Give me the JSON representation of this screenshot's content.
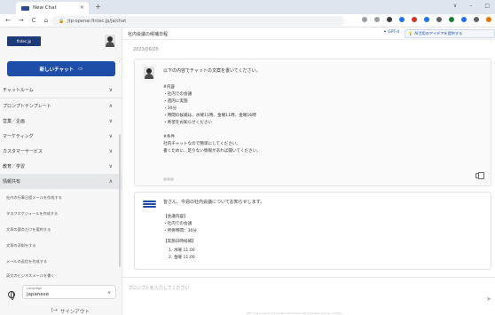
{
  "browser": {
    "tab_title": "New Chat",
    "tab_close": "×",
    "new_tab": "+",
    "window_controls": [
      "∨",
      "–",
      "□"
    ],
    "back": "←",
    "forward": "→",
    "reload": "C",
    "home": "⌂",
    "url": "jtp-openai.fintec.jp/ja/chat"
  },
  "sidebar": {
    "logo_text": "fintec.jp",
    "new_chat_label": "新しいチャット",
    "items": [
      {
        "label": "チャットルーム",
        "chevron": "∨"
      },
      {
        "label": "プロンプトテンプレート",
        "chevron": "∧"
      },
      {
        "label": "営業／企画",
        "chevron": "∨"
      },
      {
        "label": "マーケティング",
        "chevron": "∨"
      },
      {
        "label": "カスタマーサービス",
        "chevron": "∨"
      },
      {
        "label": "教育／学習",
        "chevron": "∨"
      },
      {
        "label": "情報共有",
        "chevron": "∧"
      }
    ],
    "sub_items": [
      "社内の行事日程メールを作成する",
      "タスクスケジュールを作成する",
      "文章の要点だけを要約する",
      "文章の添削をする",
      "メールの返信を作成する",
      "英文のビジネスメールを書く"
    ],
    "language_label": "Language",
    "language_value": "Japanese",
    "language_chevron": "∨",
    "signout_label": "サインアウト"
  },
  "main": {
    "title": "社内会議の候補日程",
    "gpt_button": "GPT-4",
    "idea_button": "AI活用のアイデアを提供する",
    "date": "2023/06/05",
    "user_message": {
      "lines": [
        "以下の内容でチャットの文案を書いてください。",
        "",
        "#内容",
        "・社内での会議",
        "・週内に実施",
        "・30分",
        "・時間の候補は、水曜11時、金曜11時、金曜16時",
        "・希望をお知らせください",
        "",
        "#条件",
        "社内チャットなので簡単にしてください。",
        "書くために、足りない情報があれば聞いてください。"
      ],
      "meta": "@@@"
    },
    "bot_message": {
      "lines": [
        "皆さん、今週の社内会議についてお知らせします。",
        "",
        "【会議内容】",
        "・社内での会議",
        "・所要時間：30分",
        "",
        "【実施日時候補】",
        "1. 水曜 11:00",
        "2. 金曜 11:00"
      ]
    },
    "prompt_placeholder": "プロンプトを入力してください",
    "send_icon": "➤",
    "footnote": "GPT may produce inaccurate information about people, places, or facts."
  },
  "colors": {
    "brand": "#1f4ea8",
    "sidebar_bg": "#f7f7f8"
  }
}
